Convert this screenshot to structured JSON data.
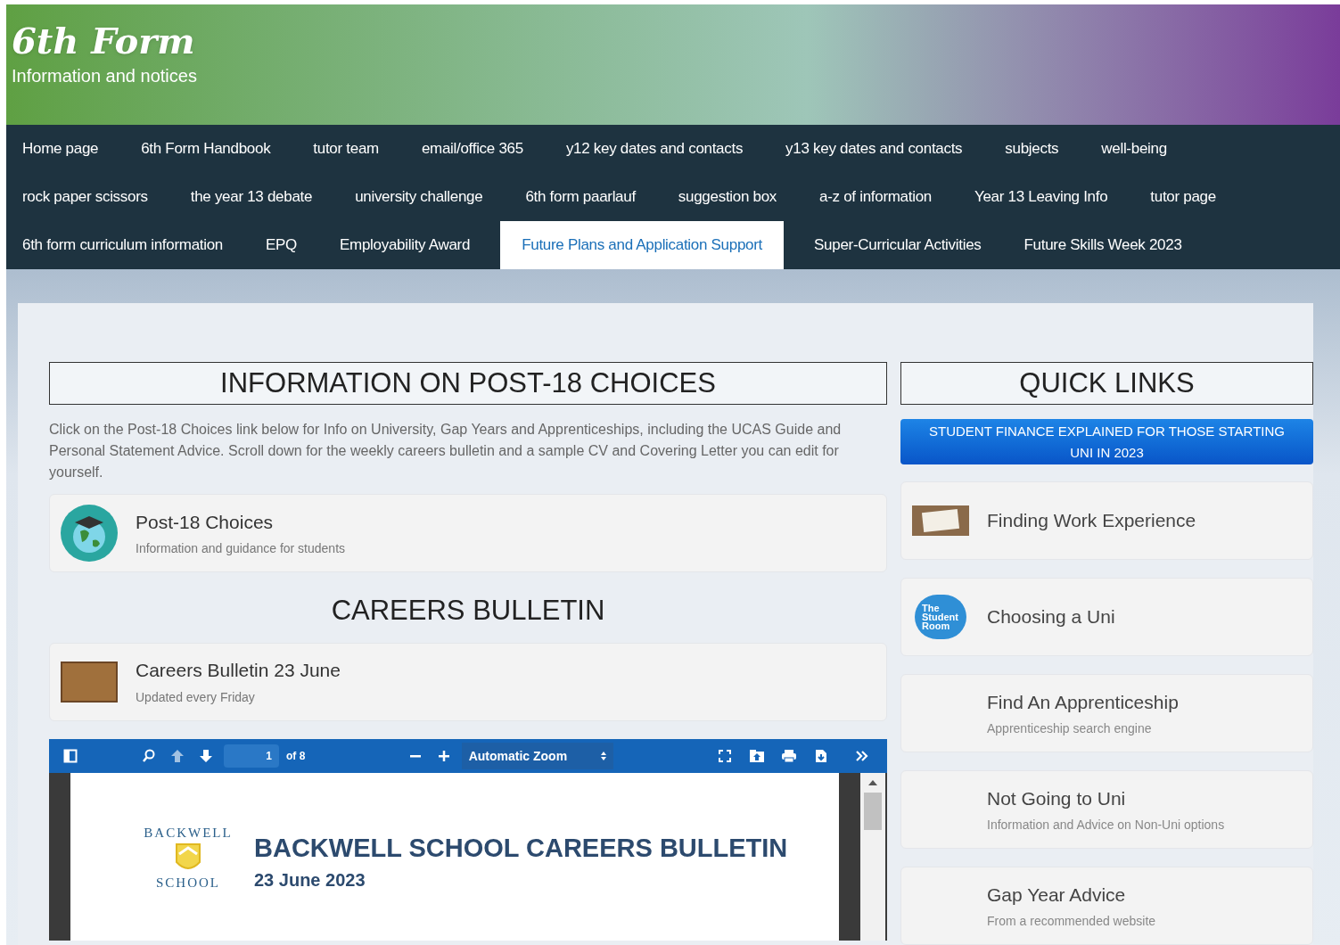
{
  "header": {
    "title": "6th Form",
    "subtitle": "Information and notices"
  },
  "nav": [
    [
      {
        "label": "Home page",
        "selected": false
      },
      {
        "label": "6th Form Handbook",
        "selected": false
      },
      {
        "label": "tutor team",
        "selected": false
      },
      {
        "label": "email/office 365",
        "selected": false
      },
      {
        "label": "y12 key dates and contacts",
        "selected": false
      },
      {
        "label": "y13 key dates and contacts",
        "selected": false
      },
      {
        "label": "subjects",
        "selected": false
      },
      {
        "label": "well-being",
        "selected": false
      }
    ],
    [
      {
        "label": "rock paper scissors",
        "selected": false
      },
      {
        "label": "the year 13 debate",
        "selected": false
      },
      {
        "label": "university challenge",
        "selected": false
      },
      {
        "label": "6th form paarlauf",
        "selected": false
      },
      {
        "label": "suggestion box",
        "selected": false
      },
      {
        "label": "a-z of information",
        "selected": false
      },
      {
        "label": "Year 13 Leaving Info",
        "selected": false
      },
      {
        "label": "tutor page",
        "selected": false
      }
    ],
    [
      {
        "label": "6th form curriculum information",
        "selected": false
      },
      {
        "label": "EPQ",
        "selected": false
      },
      {
        "label": "Employability Award",
        "selected": false
      },
      {
        "label": "Future Plans and Application Support",
        "selected": true
      },
      {
        "label": "Super-Curricular Activities",
        "selected": false
      },
      {
        "label": "Future Skills Week 2023",
        "selected": false
      }
    ]
  ],
  "main": {
    "heading": "INFORMATION ON POST-18 CHOICES",
    "intro": "Click on the Post-18 Choices link below for Info on University, Gap Years and Apprenticeships, including the UCAS Guide and Personal Statement Advice. Scroll down for the weekly careers bulletin and a sample CV and Covering Letter you can edit for yourself.",
    "post18": {
      "title": "Post-18 Choices",
      "subtitle": "Information and guidance for students"
    },
    "bulletin_heading": "CAREERS BULLETIN",
    "bulletin": {
      "title": "Careers Bulletin 23 June",
      "subtitle": "Updated every Friday"
    },
    "viewer": {
      "page": "1",
      "page_count": "of 8",
      "zoom": "Automatic Zoom",
      "doc_title": "BACKWELL SCHOOL CAREERS BULLETIN",
      "doc_date": "23 June 2023",
      "logo_top": "BACKWELL",
      "logo_bottom": "SCHOOL"
    }
  },
  "quick_links": {
    "heading": "QUICK LINKS",
    "button": "STUDENT FINANCE EXPLAINED FOR THOSE STARTING UNI IN 2023",
    "items": [
      {
        "kind": "photo",
        "title": "Finding Work Experience"
      },
      {
        "kind": "logo",
        "title": "Choosing a Uni",
        "logo_text": "The Student Room"
      },
      {
        "kind": "plain",
        "title": "Find An Apprenticeship",
        "subtitle": "Apprenticeship search engine"
      },
      {
        "kind": "plain",
        "title": "Not Going to Uni",
        "subtitle": "Information and Advice on Non-Uni options"
      },
      {
        "kind": "plain",
        "title": "Gap Year Advice",
        "subtitle": "From a recommended website"
      }
    ]
  }
}
